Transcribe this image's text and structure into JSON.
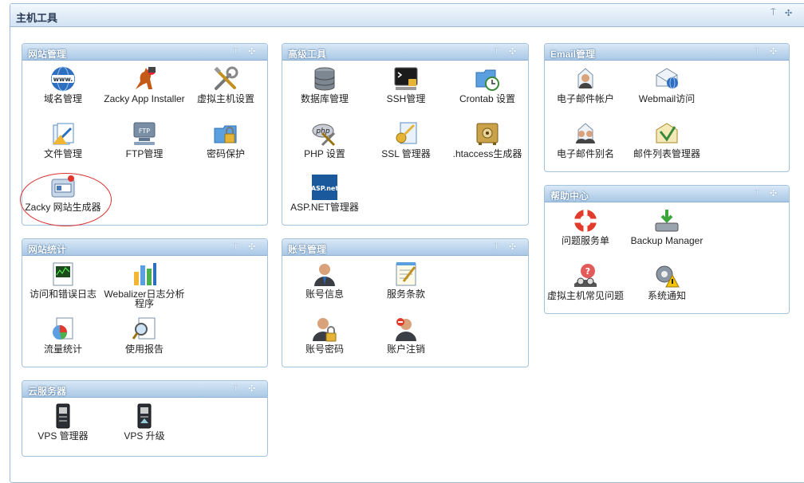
{
  "main_title": "主机工具",
  "controls": {
    "pin": "⍑",
    "move": "✣"
  },
  "panels": {
    "site": {
      "title": "网站管理",
      "items": [
        "域名管理",
        "Zacky App Installer",
        "虚拟主机设置",
        "文件管理",
        "FTP管理",
        "密码保护",
        "Zacky 网站生成器"
      ]
    },
    "advanced": {
      "title": "高级工具",
      "items": [
        "数据库管理",
        "SSH管理",
        "Crontab 设置",
        "PHP 设置",
        "SSL 管理器",
        ".htaccess生成器",
        "ASP.NET管理器"
      ]
    },
    "email": {
      "title": "Email管理",
      "items": [
        "电子邮件帐户",
        "Webmail访问",
        "电子邮件别名",
        "邮件列表管理器"
      ]
    },
    "stats": {
      "title": "网站统计",
      "items": [
        "访问和错误日志",
        "Webalizer日志分析程序",
        "流量统计",
        "使用报告"
      ]
    },
    "account": {
      "title": "账号管理",
      "items": [
        "账号信息",
        "服务条款",
        "账号密码",
        "账户注销"
      ]
    },
    "help": {
      "title": "帮助中心",
      "items": [
        "问题服务单",
        "Backup Manager",
        "虚拟主机常见问题",
        "系统通知"
      ]
    },
    "cloud": {
      "title": "云服务器",
      "items": [
        "VPS 管理器",
        "VPS 升级"
      ]
    }
  },
  "icon_text": {
    "www": "www.",
    "ftp": "FTP",
    "php": "php",
    "asp": "ASP.net"
  },
  "colors": {
    "panel_border": "#a3c2de",
    "header_blue": "#a9c8e6",
    "highlight": "#dd3333"
  }
}
